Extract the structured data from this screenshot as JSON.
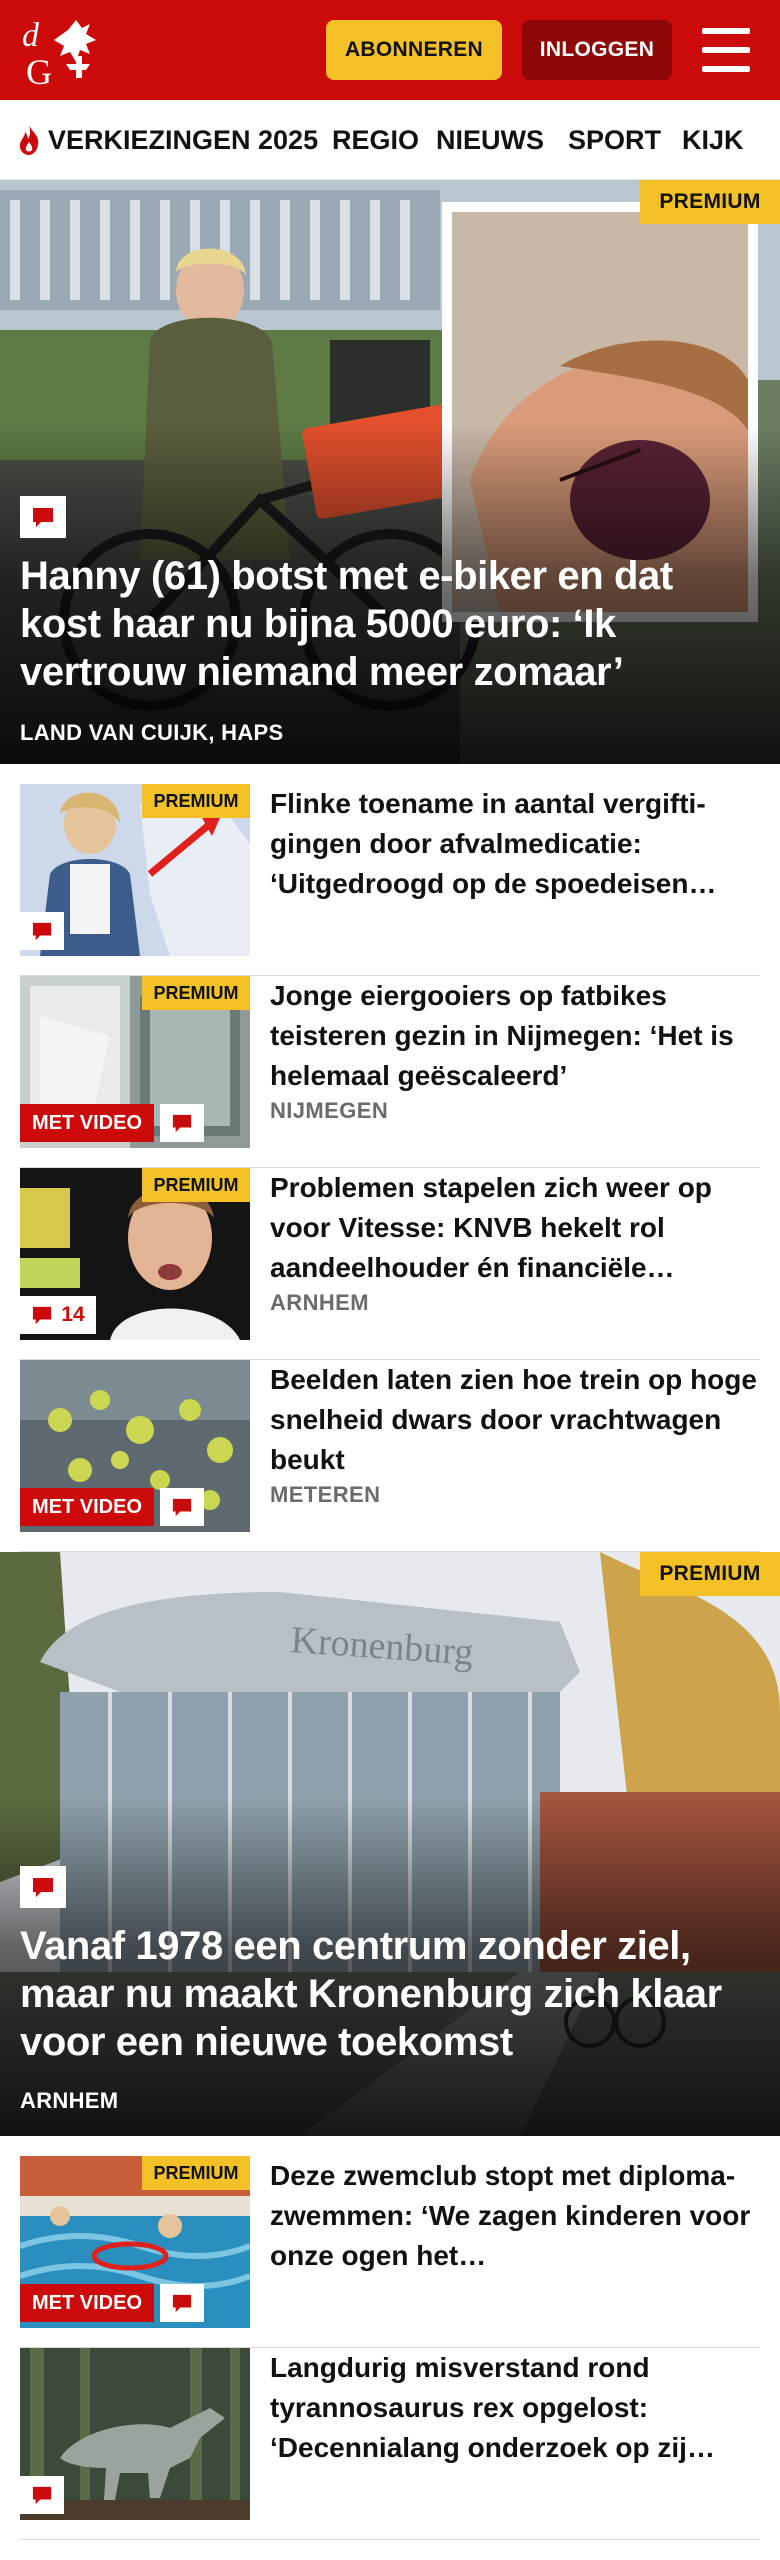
{
  "header": {
    "logo_letters": "dG",
    "subscribe_label": "ABONNEREN",
    "login_label": "INLOGGEN"
  },
  "nav": {
    "items": [
      {
        "label": "VERKIEZINGEN 2025",
        "icon": "flame-icon"
      },
      {
        "label": "REGIO"
      },
      {
        "label": "NIEUWS"
      },
      {
        "label": "SPORT"
      },
      {
        "label": "KIJK"
      }
    ]
  },
  "hero1": {
    "premium": "PREMIUM",
    "title": "Hanny (61) botst met e-biker en dat kost haar nu bijna 5000 euro: ‘Ik vertrouw niemand meer zomaar’",
    "location": "LAND VAN CUIJK, HAPS",
    "icon": "comment-icon"
  },
  "list1": [
    {
      "title": "Flinke toename in aantal vergifti­gingen door afvalmedicatie: ‘Uitgedroogd op de spoedeisen…",
      "location": "",
      "premium": "PREMIUM",
      "video": "",
      "comments": ""
    },
    {
      "title": "Jonge eiergooiers op fatbikes teisteren gezin in Nijmegen: ‘Het is helemaal geëscaleerd’",
      "location": "NIJMEGEN",
      "premium": "PREMIUM",
      "video": "MET VIDEO",
      "comments": ""
    },
    {
      "title": "Problemen stapelen zich weer op voor Vitesse: KNVB hekelt rol aandeelhouder én financiële…",
      "location": "ARNHEM",
      "premium": "PREMIUM",
      "video": "",
      "comments": "14"
    },
    {
      "title": "Beelden laten zien hoe trein op hoge snelheid dwars door vrachtwagen beukt",
      "location": "METEREN",
      "premium": "",
      "video": "MET VIDEO",
      "comments": ""
    }
  ],
  "hero2": {
    "premium": "PREMIUM",
    "building_sign": "Kronenburg",
    "title": "Vanaf 1978 een centrum zonder ziel, maar nu maakt Kronenburg zich klaar voor een nieuwe toekomst",
    "location": "ARNHEM",
    "icon": "comment-icon"
  },
  "list2": [
    {
      "title": "Deze zwemclub stopt met diploma-zwemmen: ‘We zagen kinderen voor onze ogen het…",
      "location": "",
      "premium": "PREMIUM",
      "video": "MET VIDEO",
      "comments": ""
    },
    {
      "title": "Langdurig misverstand rond tyrannosaurus rex opgelost: ‘Decennialang onderzoek op zij…",
      "location": "",
      "premium": "",
      "video": "",
      "comments": ""
    }
  ],
  "colors": {
    "brand_red": "#cc0a0a",
    "dark_red": "#8e0808",
    "premium_yellow": "#f3c125",
    "meta_gray": "#6b6b6b"
  }
}
